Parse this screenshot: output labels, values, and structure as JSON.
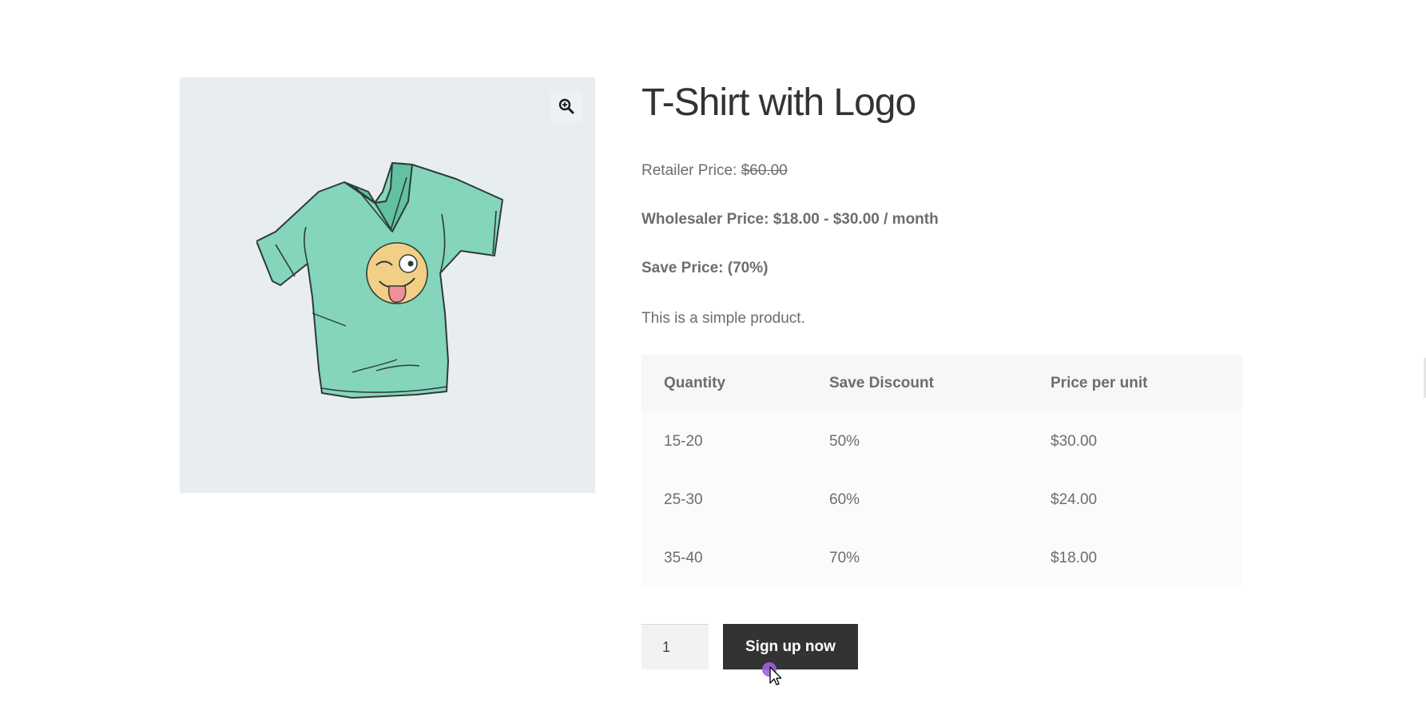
{
  "product": {
    "title": "T-Shirt with Logo",
    "retailer_label": "Retailer Price: ",
    "retailer_price": "$60.00",
    "wholesaler_label": "Wholesaler Price: $18.00 - $30.00 / month",
    "save_label": "Save Price: (70%)",
    "description": "This is a simple product."
  },
  "gallery": {
    "zoom_icon": "magnifier-zoom-icon",
    "image": "tshirt-with-logo"
  },
  "tier_table": {
    "headers": [
      "Quantity",
      "Save Discount",
      "Price per unit"
    ],
    "rows": [
      [
        "15-20",
        "50%",
        "$30.00"
      ],
      [
        "25-30",
        "60%",
        "$24.00"
      ],
      [
        "35-40",
        "70%",
        "$18.00"
      ]
    ]
  },
  "cart": {
    "quantity": "1",
    "button_label": "Sign up now"
  },
  "colors": {
    "button_bg": "#333333",
    "gallery_bg": "#e8edf0",
    "shirt": "#7fd3b8",
    "cursor_dot": "#a060e0"
  }
}
